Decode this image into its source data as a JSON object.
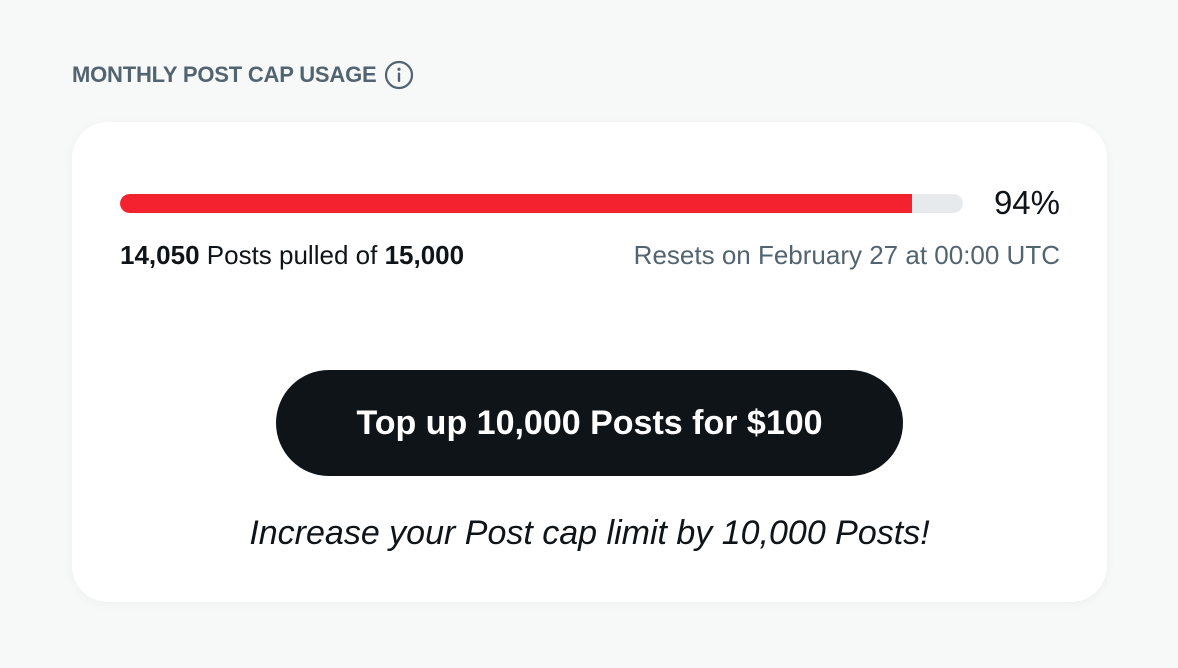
{
  "header": {
    "title": "MONTHLY POST CAP USAGE",
    "info_icon": "info-circle-icon"
  },
  "usage": {
    "percent_label": "94%",
    "fraction_used": 0.94,
    "pulled": "14,050",
    "pulled_of_text": "Posts pulled of",
    "cap": "15,000",
    "reset_text": "Resets on February 27 at 00:00 UTC"
  },
  "topup": {
    "button_label": "Top up 10,000 Posts for $100",
    "promo_text": "Increase your Post cap limit by 10,000 Posts!"
  },
  "colors": {
    "progress_fill": "#f4212e",
    "progress_track": "#e7eaec",
    "button_bg": "#0f1419",
    "muted_text": "#536471"
  }
}
